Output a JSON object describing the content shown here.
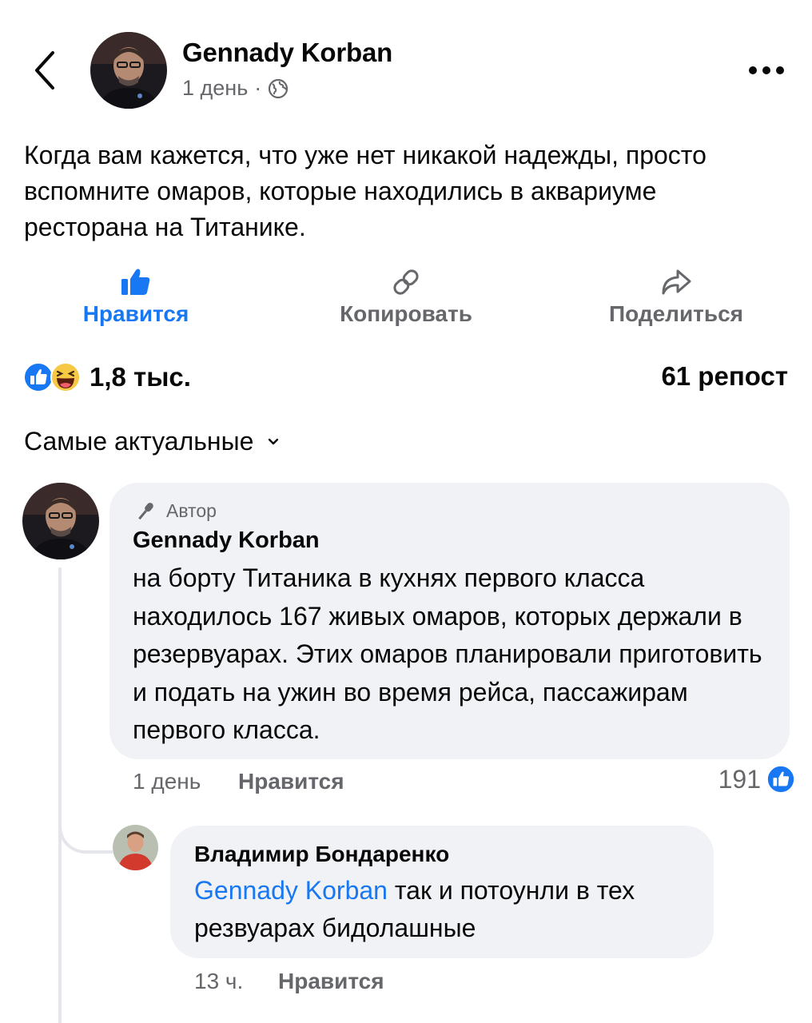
{
  "header": {
    "author_name": "Gennady Korban",
    "time": "1 день",
    "separator": "·",
    "back_icon": "chevron-left-icon",
    "privacy_icon": "globe-icon",
    "more_icon": "more-horizontal-icon"
  },
  "post": {
    "text": "Когда вам кажется, что уже нет никакой надежды, просто вспомните омаров, которые находились в аквариуме ресторана на Титанике."
  },
  "actions": {
    "like_label": "Нравится",
    "copy_label": "Копировать",
    "share_label": "Поделиться"
  },
  "stats": {
    "reactions_count": "1,8 тыс.",
    "reposts": "61 репост"
  },
  "comments_sort": {
    "label": "Самые актуальные"
  },
  "comments": [
    {
      "badge": "Автор",
      "author": "Gennady Korban",
      "text": "на борту Титаника в кухнях первого класса находилось 167 живых омаров, которых держали в резервуарах. Этих омаров планировали приготовить и подать на ужин во время рейса, пассажирам первого класса.",
      "time": "1 день",
      "like_label": "Нравится",
      "likes": "191"
    },
    {
      "author": "Владимир Бондаренко",
      "mention": "Gennady Korban",
      "text": " так и потоунли в тех резвуарах бидолашные",
      "time": "13 ч.",
      "like_label": "Нравится"
    }
  ],
  "colors": {
    "accent": "#1877f2",
    "secondary_text": "#65676b",
    "bubble": "#f0f2f5",
    "haha_yellow": "#f7c844"
  }
}
